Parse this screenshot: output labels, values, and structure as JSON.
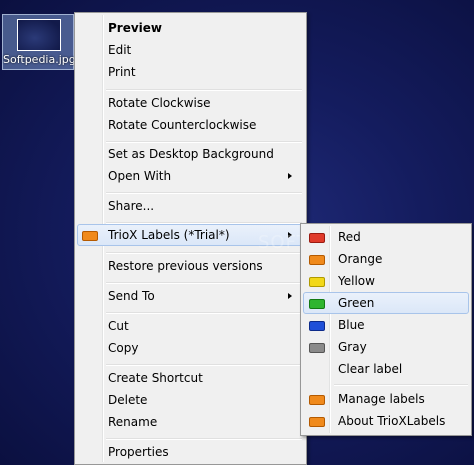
{
  "desktop": {
    "file_label": "Softpedia.jpg"
  },
  "context_menu": {
    "items": {
      "preview": "Preview",
      "edit": "Edit",
      "print": "Print",
      "rotate_cw": "Rotate Clockwise",
      "rotate_ccw": "Rotate Counterclockwise",
      "set_bg": "Set as Desktop Background",
      "open_with": "Open With",
      "share": "Share...",
      "triox": "TrioX Labels  (*Trial*)",
      "restore": "Restore previous versions",
      "send_to": "Send To",
      "cut": "Cut",
      "copy": "Copy",
      "create_shortcut": "Create Shortcut",
      "delete": "Delete",
      "rename": "Rename",
      "properties": "Properties"
    }
  },
  "submenu": {
    "red": "Red",
    "orange": "Orange",
    "yellow": "Yellow",
    "green": "Green",
    "blue": "Blue",
    "gray": "Gray",
    "clear": "Clear label",
    "manage": "Manage labels",
    "about": "About TrioXLabels"
  },
  "colors": {
    "red": "#e03a2a",
    "orange": "#f08a1c",
    "yellow": "#f2d81a",
    "green": "#2fb52f",
    "blue": "#1f4fd8",
    "gray": "#8a8a8a",
    "triox_icon": "#f08a1c"
  },
  "watermark": "SOFTPEDIA"
}
